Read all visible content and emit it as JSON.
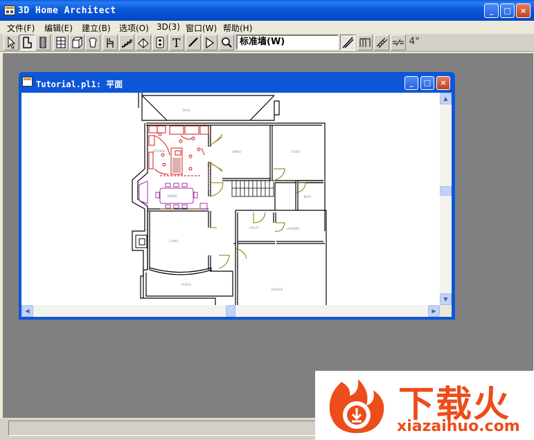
{
  "app": {
    "title": "3D Home Architect"
  },
  "title_buttons": {
    "minimize": "_",
    "maximize": "□",
    "close": "×"
  },
  "menu": [
    {
      "label": "文件(F)"
    },
    {
      "label": "编辑(E)"
    },
    {
      "label": "建立(B)"
    },
    {
      "label": "选项(O)"
    },
    {
      "label": "3D(3)"
    },
    {
      "label": "窗口(W)"
    },
    {
      "label": "帮助(H)"
    }
  ],
  "toolbar": {
    "tools": [
      "select-arrow-icon",
      "wall-tool-icon",
      "door-tool-icon",
      "window-tool-icon",
      "cabinet-tool-icon",
      "fixture-tool-icon",
      "furniture-tool-icon",
      "stairs-tool-icon",
      "roof-tool-icon",
      "electrical-tool-icon",
      "text-tool-icon",
      "dimension-tool-icon",
      "camera-tool-icon",
      "zoom-tool-icon"
    ],
    "wall_type": "标准墙(W)",
    "wall_options": [
      "straight-wall-icon",
      "railing-icon",
      "ladder-icon",
      "break-wall-icon"
    ],
    "thickness_label": "4\""
  },
  "child_window": {
    "title": "Tutorial.pl1: 平面",
    "rooms": [
      "DECK",
      "KITCHEN",
      "FAMILY",
      "STUDY",
      "DINING",
      "BATH",
      "UTILITY",
      "LAUNDRY",
      "LIVING",
      "PORCH",
      "GARAGE"
    ]
  },
  "watermark": {
    "brand_cn": "下载火",
    "url": "xiazaihuo.com"
  },
  "colors": {
    "title_blue": "#0a58d8",
    "mdi_gray": "#808080",
    "watermark_orange": "#ec4d1b",
    "kitchen_red": "#cc0000",
    "dining_purple": "#a030a0"
  }
}
